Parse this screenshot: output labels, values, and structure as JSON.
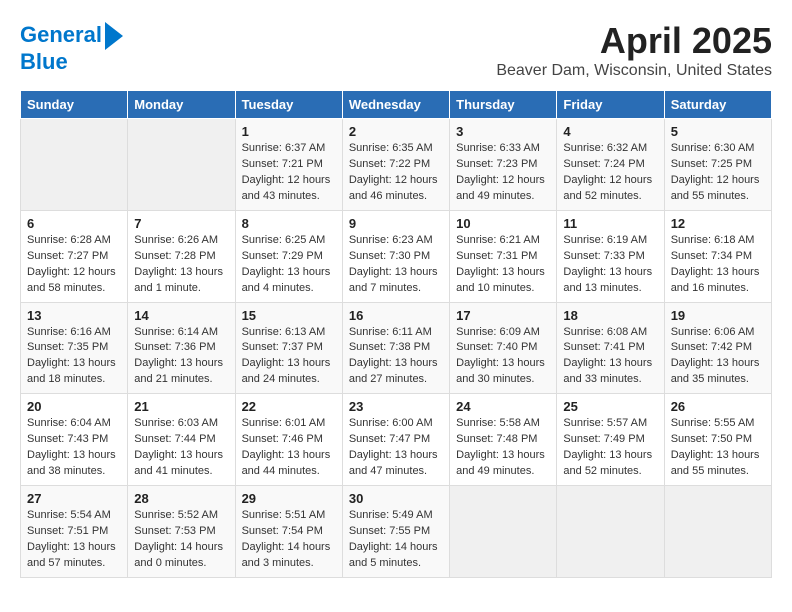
{
  "logo": {
    "line1": "General",
    "line2": "Blue"
  },
  "title": "April 2025",
  "location": "Beaver Dam, Wisconsin, United States",
  "days_of_week": [
    "Sunday",
    "Monday",
    "Tuesday",
    "Wednesday",
    "Thursday",
    "Friday",
    "Saturday"
  ],
  "weeks": [
    [
      {
        "day": "",
        "content": ""
      },
      {
        "day": "",
        "content": ""
      },
      {
        "day": "1",
        "content": "Sunrise: 6:37 AM\nSunset: 7:21 PM\nDaylight: 12 hours and 43 minutes."
      },
      {
        "day": "2",
        "content": "Sunrise: 6:35 AM\nSunset: 7:22 PM\nDaylight: 12 hours and 46 minutes."
      },
      {
        "day": "3",
        "content": "Sunrise: 6:33 AM\nSunset: 7:23 PM\nDaylight: 12 hours and 49 minutes."
      },
      {
        "day": "4",
        "content": "Sunrise: 6:32 AM\nSunset: 7:24 PM\nDaylight: 12 hours and 52 minutes."
      },
      {
        "day": "5",
        "content": "Sunrise: 6:30 AM\nSunset: 7:25 PM\nDaylight: 12 hours and 55 minutes."
      }
    ],
    [
      {
        "day": "6",
        "content": "Sunrise: 6:28 AM\nSunset: 7:27 PM\nDaylight: 12 hours and 58 minutes."
      },
      {
        "day": "7",
        "content": "Sunrise: 6:26 AM\nSunset: 7:28 PM\nDaylight: 13 hours and 1 minute."
      },
      {
        "day": "8",
        "content": "Sunrise: 6:25 AM\nSunset: 7:29 PM\nDaylight: 13 hours and 4 minutes."
      },
      {
        "day": "9",
        "content": "Sunrise: 6:23 AM\nSunset: 7:30 PM\nDaylight: 13 hours and 7 minutes."
      },
      {
        "day": "10",
        "content": "Sunrise: 6:21 AM\nSunset: 7:31 PM\nDaylight: 13 hours and 10 minutes."
      },
      {
        "day": "11",
        "content": "Sunrise: 6:19 AM\nSunset: 7:33 PM\nDaylight: 13 hours and 13 minutes."
      },
      {
        "day": "12",
        "content": "Sunrise: 6:18 AM\nSunset: 7:34 PM\nDaylight: 13 hours and 16 minutes."
      }
    ],
    [
      {
        "day": "13",
        "content": "Sunrise: 6:16 AM\nSunset: 7:35 PM\nDaylight: 13 hours and 18 minutes."
      },
      {
        "day": "14",
        "content": "Sunrise: 6:14 AM\nSunset: 7:36 PM\nDaylight: 13 hours and 21 minutes."
      },
      {
        "day": "15",
        "content": "Sunrise: 6:13 AM\nSunset: 7:37 PM\nDaylight: 13 hours and 24 minutes."
      },
      {
        "day": "16",
        "content": "Sunrise: 6:11 AM\nSunset: 7:38 PM\nDaylight: 13 hours and 27 minutes."
      },
      {
        "day": "17",
        "content": "Sunrise: 6:09 AM\nSunset: 7:40 PM\nDaylight: 13 hours and 30 minutes."
      },
      {
        "day": "18",
        "content": "Sunrise: 6:08 AM\nSunset: 7:41 PM\nDaylight: 13 hours and 33 minutes."
      },
      {
        "day": "19",
        "content": "Sunrise: 6:06 AM\nSunset: 7:42 PM\nDaylight: 13 hours and 35 minutes."
      }
    ],
    [
      {
        "day": "20",
        "content": "Sunrise: 6:04 AM\nSunset: 7:43 PM\nDaylight: 13 hours and 38 minutes."
      },
      {
        "day": "21",
        "content": "Sunrise: 6:03 AM\nSunset: 7:44 PM\nDaylight: 13 hours and 41 minutes."
      },
      {
        "day": "22",
        "content": "Sunrise: 6:01 AM\nSunset: 7:46 PM\nDaylight: 13 hours and 44 minutes."
      },
      {
        "day": "23",
        "content": "Sunrise: 6:00 AM\nSunset: 7:47 PM\nDaylight: 13 hours and 47 minutes."
      },
      {
        "day": "24",
        "content": "Sunrise: 5:58 AM\nSunset: 7:48 PM\nDaylight: 13 hours and 49 minutes."
      },
      {
        "day": "25",
        "content": "Sunrise: 5:57 AM\nSunset: 7:49 PM\nDaylight: 13 hours and 52 minutes."
      },
      {
        "day": "26",
        "content": "Sunrise: 5:55 AM\nSunset: 7:50 PM\nDaylight: 13 hours and 55 minutes."
      }
    ],
    [
      {
        "day": "27",
        "content": "Sunrise: 5:54 AM\nSunset: 7:51 PM\nDaylight: 13 hours and 57 minutes."
      },
      {
        "day": "28",
        "content": "Sunrise: 5:52 AM\nSunset: 7:53 PM\nDaylight: 14 hours and 0 minutes."
      },
      {
        "day": "29",
        "content": "Sunrise: 5:51 AM\nSunset: 7:54 PM\nDaylight: 14 hours and 3 minutes."
      },
      {
        "day": "30",
        "content": "Sunrise: 5:49 AM\nSunset: 7:55 PM\nDaylight: 14 hours and 5 minutes."
      },
      {
        "day": "",
        "content": ""
      },
      {
        "day": "",
        "content": ""
      },
      {
        "day": "",
        "content": ""
      }
    ]
  ]
}
